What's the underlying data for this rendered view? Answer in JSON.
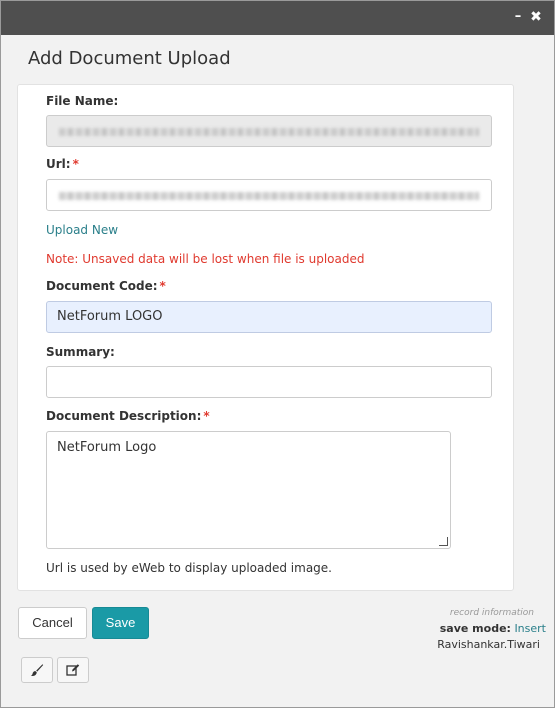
{
  "window": {
    "minimize_glyph": "–",
    "close_glyph": "✖"
  },
  "dialog": {
    "title": "Add Document Upload"
  },
  "form": {
    "file_name_label": "File Name:",
    "file_name_value": "",
    "url_label": "Url:",
    "url_value": "",
    "required_mark": "*",
    "upload_link": "Upload New",
    "note": "Note: Unsaved data will be lost when file is uploaded",
    "document_code_label": "Document Code:",
    "document_code_value": "NetForum LOGO",
    "summary_label": "Summary:",
    "summary_value": "",
    "description_label": "Document Description:",
    "description_value": "NetForum Logo",
    "helper_text": "Url is used by eWeb to display uploaded image."
  },
  "actions": {
    "cancel_label": "Cancel",
    "save_label": "Save"
  },
  "record": {
    "info_label": "record information",
    "save_mode_label": "save mode:",
    "save_mode_value": "Insert",
    "user": "Ravishankar.Tiwari"
  },
  "colors": {
    "accent": "#1a9aa6",
    "required": "#e03a2f",
    "link": "#2a7f8a",
    "titlebar": "#4f4f4f"
  },
  "icons": {
    "brush": "brush-icon",
    "edit": "edit-icon",
    "minimize": "minimize-icon",
    "close": "close-icon"
  }
}
